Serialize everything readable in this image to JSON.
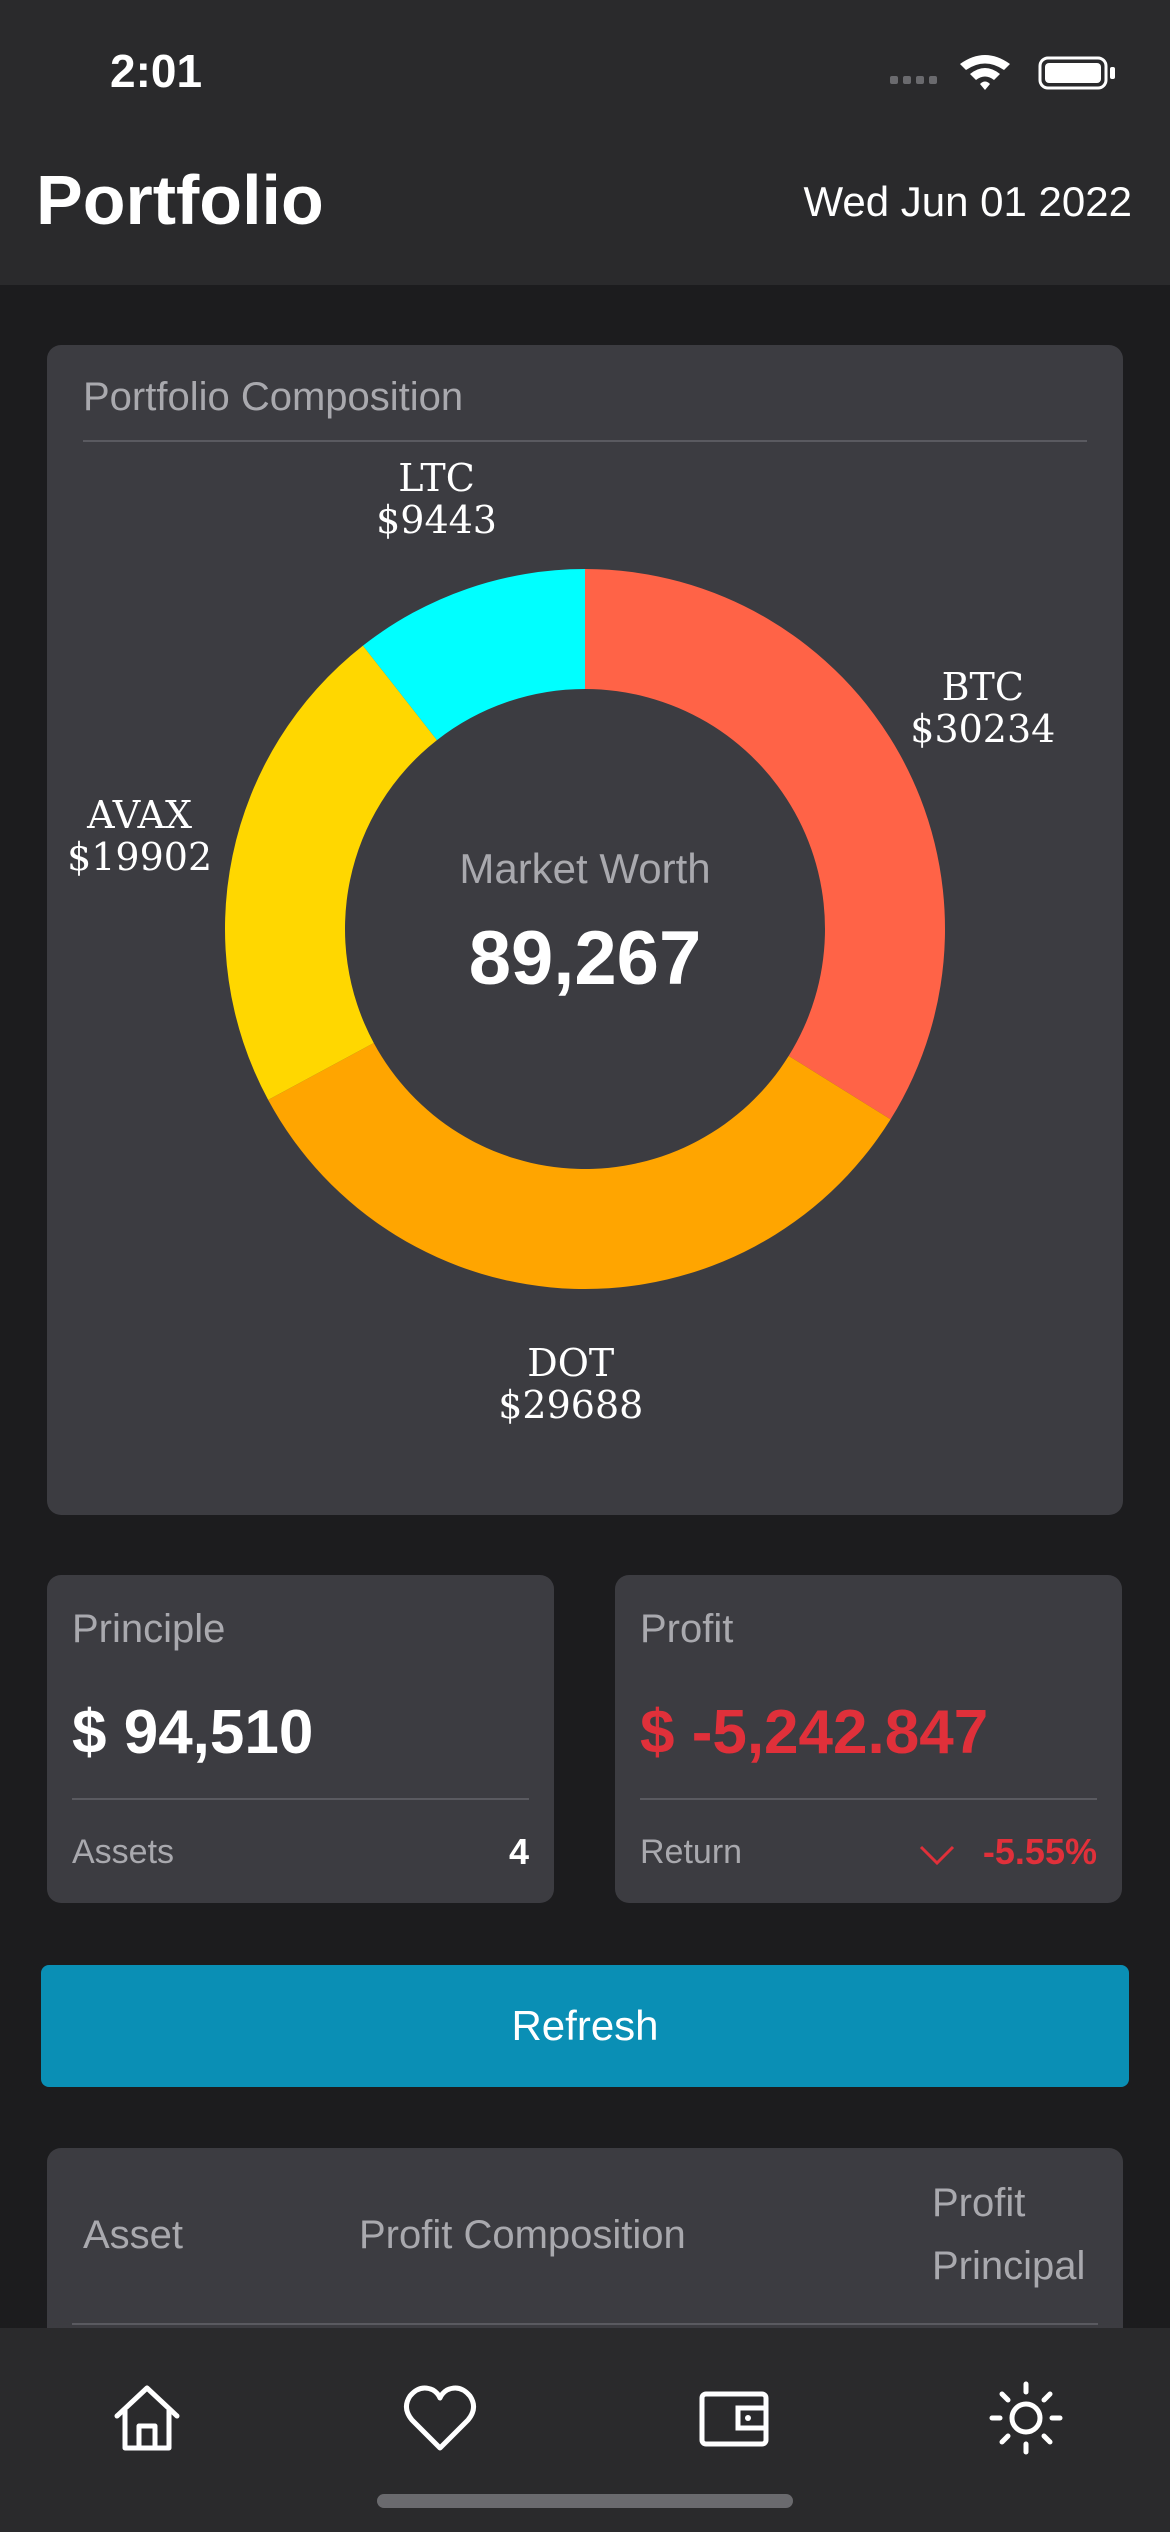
{
  "status_bar": {
    "time": "2:01"
  },
  "header": {
    "title": "Portfolio",
    "date": "Wed Jun 01 2022"
  },
  "composition": {
    "title": "Portfolio Composition",
    "center_label": "Market Worth",
    "center_value": "89,267"
  },
  "chart_data": {
    "type": "pie",
    "donut": true,
    "slices": [
      {
        "name": "BTC",
        "label": "$30234",
        "value": 30234,
        "color": "#ff6347"
      },
      {
        "name": "DOT",
        "label": "$29688",
        "value": 29688,
        "color": "#ffa500"
      },
      {
        "name": "AVAX",
        "label": "$19902",
        "value": 19902,
        "color": "#ffd700"
      },
      {
        "name": "LTC",
        "label": "$9443",
        "value": 9443,
        "color": "#00ffff"
      }
    ]
  },
  "principle_card": {
    "title": "Principle",
    "value": "$ 94,510",
    "foot_label": "Assets",
    "foot_value": "4"
  },
  "profit_card": {
    "title": "Profit",
    "value": "$ -5,242.847",
    "foot_label": "Return",
    "foot_value": "-5.55%"
  },
  "refresh_label": "Refresh",
  "table": {
    "headers": {
      "asset": "Asset",
      "composition": "Profit Composition",
      "profit": "Profit",
      "principal": "Principal"
    }
  },
  "tabbar": {
    "items": [
      {
        "icon": "home-icon"
      },
      {
        "icon": "heart-icon"
      },
      {
        "icon": "wallet-icon"
      },
      {
        "icon": "sun-icon"
      }
    ]
  },
  "colors": {
    "accent": "#0a8fb5",
    "negative": "#e0303a"
  }
}
